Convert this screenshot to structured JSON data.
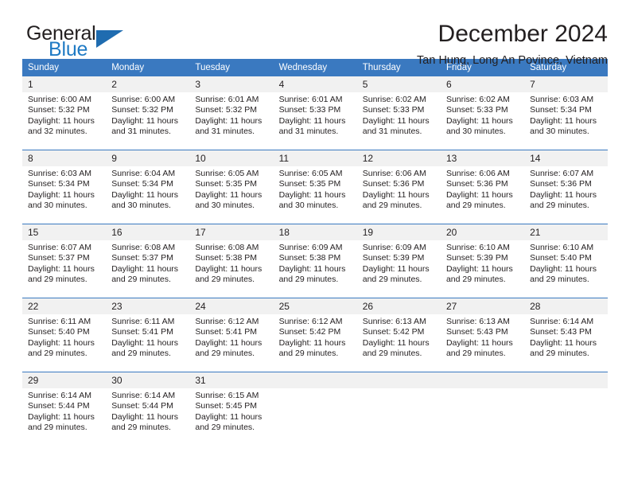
{
  "brand": {
    "name_part1": "General",
    "name_part2": "Blue",
    "triangle_color": "#1f6cb0",
    "blue_text_color": "#1f7ac4"
  },
  "header": {
    "title": "December 2024",
    "subtitle": "Tan Hung, Long An Povince, Vietnam"
  },
  "theme": {
    "header_bar_color": "#3a79c0",
    "daynum_band_color": "#f1f1f1",
    "text_color": "#231f20",
    "page_background": "#ffffff"
  },
  "calendar": {
    "weekday_headers": [
      "Sunday",
      "Monday",
      "Tuesday",
      "Wednesday",
      "Thursday",
      "Friday",
      "Saturday"
    ],
    "weeks": [
      {
        "days": [
          {
            "num": "1",
            "sunrise": "Sunrise: 6:00 AM",
            "sunset": "Sunset: 5:32 PM",
            "daylight_1": "Daylight: 11 hours",
            "daylight_2": "and 32 minutes."
          },
          {
            "num": "2",
            "sunrise": "Sunrise: 6:00 AM",
            "sunset": "Sunset: 5:32 PM",
            "daylight_1": "Daylight: 11 hours",
            "daylight_2": "and 31 minutes."
          },
          {
            "num": "3",
            "sunrise": "Sunrise: 6:01 AM",
            "sunset": "Sunset: 5:32 PM",
            "daylight_1": "Daylight: 11 hours",
            "daylight_2": "and 31 minutes."
          },
          {
            "num": "4",
            "sunrise": "Sunrise: 6:01 AM",
            "sunset": "Sunset: 5:33 PM",
            "daylight_1": "Daylight: 11 hours",
            "daylight_2": "and 31 minutes."
          },
          {
            "num": "5",
            "sunrise": "Sunrise: 6:02 AM",
            "sunset": "Sunset: 5:33 PM",
            "daylight_1": "Daylight: 11 hours",
            "daylight_2": "and 31 minutes."
          },
          {
            "num": "6",
            "sunrise": "Sunrise: 6:02 AM",
            "sunset": "Sunset: 5:33 PM",
            "daylight_1": "Daylight: 11 hours",
            "daylight_2": "and 30 minutes."
          },
          {
            "num": "7",
            "sunrise": "Sunrise: 6:03 AM",
            "sunset": "Sunset: 5:34 PM",
            "daylight_1": "Daylight: 11 hours",
            "daylight_2": "and 30 minutes."
          }
        ]
      },
      {
        "days": [
          {
            "num": "8",
            "sunrise": "Sunrise: 6:03 AM",
            "sunset": "Sunset: 5:34 PM",
            "daylight_1": "Daylight: 11 hours",
            "daylight_2": "and 30 minutes."
          },
          {
            "num": "9",
            "sunrise": "Sunrise: 6:04 AM",
            "sunset": "Sunset: 5:34 PM",
            "daylight_1": "Daylight: 11 hours",
            "daylight_2": "and 30 minutes."
          },
          {
            "num": "10",
            "sunrise": "Sunrise: 6:05 AM",
            "sunset": "Sunset: 5:35 PM",
            "daylight_1": "Daylight: 11 hours",
            "daylight_2": "and 30 minutes."
          },
          {
            "num": "11",
            "sunrise": "Sunrise: 6:05 AM",
            "sunset": "Sunset: 5:35 PM",
            "daylight_1": "Daylight: 11 hours",
            "daylight_2": "and 30 minutes."
          },
          {
            "num": "12",
            "sunrise": "Sunrise: 6:06 AM",
            "sunset": "Sunset: 5:36 PM",
            "daylight_1": "Daylight: 11 hours",
            "daylight_2": "and 29 minutes."
          },
          {
            "num": "13",
            "sunrise": "Sunrise: 6:06 AM",
            "sunset": "Sunset: 5:36 PM",
            "daylight_1": "Daylight: 11 hours",
            "daylight_2": "and 29 minutes."
          },
          {
            "num": "14",
            "sunrise": "Sunrise: 6:07 AM",
            "sunset": "Sunset: 5:36 PM",
            "daylight_1": "Daylight: 11 hours",
            "daylight_2": "and 29 minutes."
          }
        ]
      },
      {
        "days": [
          {
            "num": "15",
            "sunrise": "Sunrise: 6:07 AM",
            "sunset": "Sunset: 5:37 PM",
            "daylight_1": "Daylight: 11 hours",
            "daylight_2": "and 29 minutes."
          },
          {
            "num": "16",
            "sunrise": "Sunrise: 6:08 AM",
            "sunset": "Sunset: 5:37 PM",
            "daylight_1": "Daylight: 11 hours",
            "daylight_2": "and 29 minutes."
          },
          {
            "num": "17",
            "sunrise": "Sunrise: 6:08 AM",
            "sunset": "Sunset: 5:38 PM",
            "daylight_1": "Daylight: 11 hours",
            "daylight_2": "and 29 minutes."
          },
          {
            "num": "18",
            "sunrise": "Sunrise: 6:09 AM",
            "sunset": "Sunset: 5:38 PM",
            "daylight_1": "Daylight: 11 hours",
            "daylight_2": "and 29 minutes."
          },
          {
            "num": "19",
            "sunrise": "Sunrise: 6:09 AM",
            "sunset": "Sunset: 5:39 PM",
            "daylight_1": "Daylight: 11 hours",
            "daylight_2": "and 29 minutes."
          },
          {
            "num": "20",
            "sunrise": "Sunrise: 6:10 AM",
            "sunset": "Sunset: 5:39 PM",
            "daylight_1": "Daylight: 11 hours",
            "daylight_2": "and 29 minutes."
          },
          {
            "num": "21",
            "sunrise": "Sunrise: 6:10 AM",
            "sunset": "Sunset: 5:40 PM",
            "daylight_1": "Daylight: 11 hours",
            "daylight_2": "and 29 minutes."
          }
        ]
      },
      {
        "days": [
          {
            "num": "22",
            "sunrise": "Sunrise: 6:11 AM",
            "sunset": "Sunset: 5:40 PM",
            "daylight_1": "Daylight: 11 hours",
            "daylight_2": "and 29 minutes."
          },
          {
            "num": "23",
            "sunrise": "Sunrise: 6:11 AM",
            "sunset": "Sunset: 5:41 PM",
            "daylight_1": "Daylight: 11 hours",
            "daylight_2": "and 29 minutes."
          },
          {
            "num": "24",
            "sunrise": "Sunrise: 6:12 AM",
            "sunset": "Sunset: 5:41 PM",
            "daylight_1": "Daylight: 11 hours",
            "daylight_2": "and 29 minutes."
          },
          {
            "num": "25",
            "sunrise": "Sunrise: 6:12 AM",
            "sunset": "Sunset: 5:42 PM",
            "daylight_1": "Daylight: 11 hours",
            "daylight_2": "and 29 minutes."
          },
          {
            "num": "26",
            "sunrise": "Sunrise: 6:13 AM",
            "sunset": "Sunset: 5:42 PM",
            "daylight_1": "Daylight: 11 hours",
            "daylight_2": "and 29 minutes."
          },
          {
            "num": "27",
            "sunrise": "Sunrise: 6:13 AM",
            "sunset": "Sunset: 5:43 PM",
            "daylight_1": "Daylight: 11 hours",
            "daylight_2": "and 29 minutes."
          },
          {
            "num": "28",
            "sunrise": "Sunrise: 6:14 AM",
            "sunset": "Sunset: 5:43 PM",
            "daylight_1": "Daylight: 11 hours",
            "daylight_2": "and 29 minutes."
          }
        ]
      },
      {
        "days": [
          {
            "num": "29",
            "sunrise": "Sunrise: 6:14 AM",
            "sunset": "Sunset: 5:44 PM",
            "daylight_1": "Daylight: 11 hours",
            "daylight_2": "and 29 minutes."
          },
          {
            "num": "30",
            "sunrise": "Sunrise: 6:14 AM",
            "sunset": "Sunset: 5:44 PM",
            "daylight_1": "Daylight: 11 hours",
            "daylight_2": "and 29 minutes."
          },
          {
            "num": "31",
            "sunrise": "Sunrise: 6:15 AM",
            "sunset": "Sunset: 5:45 PM",
            "daylight_1": "Daylight: 11 hours",
            "daylight_2": "and 29 minutes."
          },
          {
            "num": "",
            "sunrise": "",
            "sunset": "",
            "daylight_1": "",
            "daylight_2": ""
          },
          {
            "num": "",
            "sunrise": "",
            "sunset": "",
            "daylight_1": "",
            "daylight_2": ""
          },
          {
            "num": "",
            "sunrise": "",
            "sunset": "",
            "daylight_1": "",
            "daylight_2": ""
          },
          {
            "num": "",
            "sunrise": "",
            "sunset": "",
            "daylight_1": "",
            "daylight_2": ""
          }
        ]
      }
    ]
  }
}
